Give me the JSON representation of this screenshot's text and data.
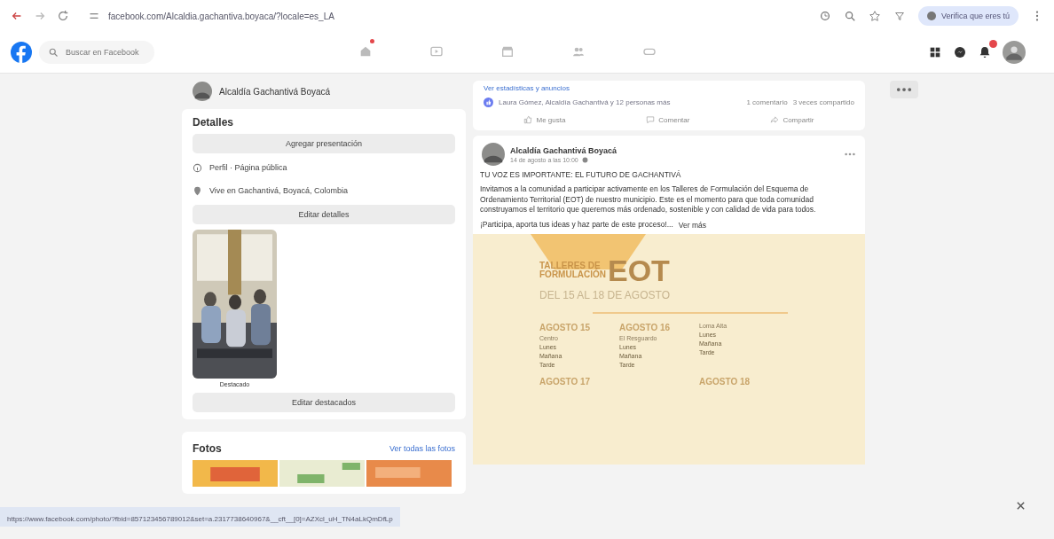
{
  "browser": {
    "url": "facebook.com/Alcaldia.gachantiva.boyaca/?locale=es_LA",
    "profile_button": "Verifica que eres tú"
  },
  "navbar": {
    "search": {
      "placeholder": "Buscar en Facebook"
    },
    "tabs": [
      {
        "kind": "home",
        "selected": false,
        "badge": true
      },
      {
        "kind": "video",
        "selected": false,
        "badge": false
      },
      {
        "kind": "store",
        "selected": false,
        "badge": false
      },
      {
        "kind": "groups",
        "selected": false,
        "badge": false
      },
      {
        "kind": "games",
        "selected": false,
        "badge": false
      }
    ],
    "actions": [
      {
        "kind": "menu",
        "badge": false
      },
      {
        "kind": "messenger",
        "badge": false
      },
      {
        "kind": "notifications",
        "badge": true
      }
    ]
  },
  "page_header": {
    "name": "Alcaldía Gachantivá Boyacá"
  },
  "details": {
    "title": "Detalles",
    "buttons": [
      "Agregar presentación",
      "Editar detalles",
      "Editar destacados"
    ],
    "rows": [
      {
        "kind": "info",
        "text": "Perfil · Página pública"
      },
      {
        "kind": "place",
        "text": "Vive en Gachantivá, Boyacá, Colombia"
      }
    ],
    "featured_caption": "Destacado"
  },
  "photos": {
    "title": "Fotos",
    "link": "Ver todas las fotos"
  },
  "post_top": {
    "link": "Ver estadísticas y anuncios",
    "reactions": "Laura Gómez, Alcaldía Gachantivá y 12 personas más",
    "comments": "1 comentario",
    "shares": "3 veces compartido",
    "actions": [
      {
        "kind": "like",
        "label": "Me gusta"
      },
      {
        "kind": "comment",
        "label": "Comentar"
      },
      {
        "kind": "share",
        "label": "Compartir"
      }
    ]
  },
  "post": {
    "author": "Alcaldía Gachantivá Boyacá",
    "date": "14 de agosto a las 10:00",
    "headline": "TU VOZ ES IMPORTANTE: EL FUTURO DE GACHANTIVÁ",
    "body": "Invitamos a la comunidad a participar activamente en los Talleres de Formulación del Esquema de Ordenamiento Territorial (EOT) de nuestro municipio. Este es el momento para que toda comunidad construyamos el territorio que queremos más ordenado, sostenible y con calidad de vida para todos.",
    "closing": "¡Participa, aporta tus ideas y haz parte de este proceso!...",
    "see_more": "Ver más",
    "poster": {
      "title_1": "TALLERES DE",
      "title_2": "FORMULACIÓN",
      "big": "EOT",
      "dates": "DEL 15 AL 18 DE AGOSTO",
      "days": [
        {
          "label": "AGOSTO 15",
          "place": "Centro",
          "items": [
            "Lunes",
            "Mañana",
            "Tarde"
          ]
        },
        {
          "label": "AGOSTO 16",
          "place": "El Resguardo",
          "items": [
            "Lunes",
            "Mañana",
            "Tarde"
          ]
        },
        {
          "place": "Loma Alta",
          "items": [
            "Lunes",
            "Mañana",
            "Tarde"
          ]
        },
        {
          "label": "AGOSTO 17"
        },
        {
          "label": "AGOSTO 18"
        }
      ]
    }
  },
  "status_link": "https://www.facebook.com/photo/?fbid=857123456789012&set=a.2317738640967&__cft__[0]=AZXcl_uH_TN4aLkQmDfLp"
}
